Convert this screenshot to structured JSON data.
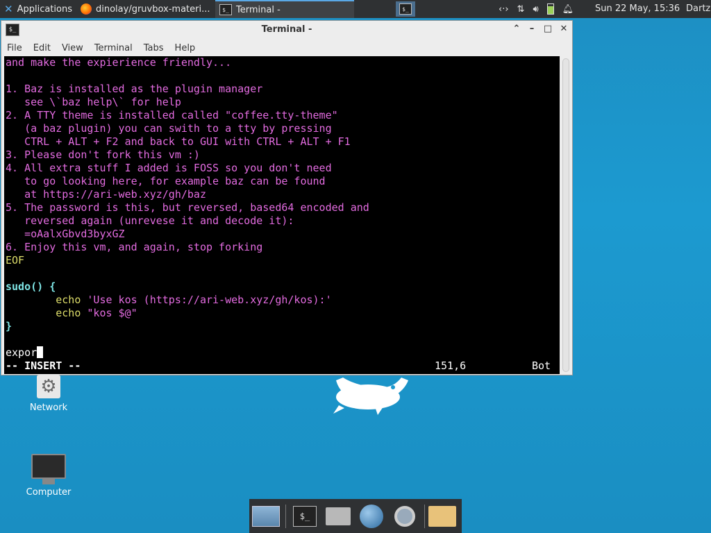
{
  "panel": {
    "applications_label": "Applications",
    "tasks": [
      {
        "label": "dinolay/gruvbox-materi..."
      },
      {
        "label": "Terminal -"
      }
    ],
    "clock": "Sun 22 May, 15:36",
    "user": "Dartz"
  },
  "window": {
    "title": "Terminal -",
    "menu": [
      "File",
      "Edit",
      "View",
      "Terminal",
      "Tabs",
      "Help"
    ]
  },
  "terminal": {
    "lines": [
      "and make the expierience friendly...",
      "",
      "1. Baz is installed as the plugin manager",
      "   see \\`baz help\\` for help",
      "2. A TTY theme is installed called \"coffee.tty-theme\"",
      "   (a baz plugin) you can swith to a tty by pressing",
      "   CTRL + ALT + F2 and back to GUI with CTRL + ALT + F1",
      "3. Please don't fork this vm :)",
      "4. All extra stuff I added is FOSS so you don't need",
      "   to go looking here, for example baz can be found",
      "   at https://ari-web.xyz/gh/baz",
      "5. The password is this, but reversed, based64 encoded and",
      "   reversed again (unrevese it and decode it):",
      "   =oAalxGbvd3byxGZ",
      "6. Enjoy this vm, and again, stop forking"
    ],
    "eof": "EOF",
    "func_decl": "sudo() {",
    "echo_kw": "echo",
    "echo1_str": "'Use kos (https://ari-web.xyz/gh/kos):'",
    "echo2_str": "\"kos $@\"",
    "close_brace": "}",
    "current_input": "expor",
    "mode": "-- INSERT --",
    "position": "151,6",
    "scroll": "Bot"
  },
  "desktop": {
    "icons": [
      {
        "label": "Network"
      },
      {
        "label": "Computer"
      }
    ]
  },
  "colors": {
    "panel_bg": "#2f3133",
    "terminal_bg": "#000000",
    "magenta_text": "#e36be0",
    "yellow_text": "#dede6a",
    "cyan_text": "#7fe6e6",
    "desktop_bg": "#1c9ad0"
  }
}
